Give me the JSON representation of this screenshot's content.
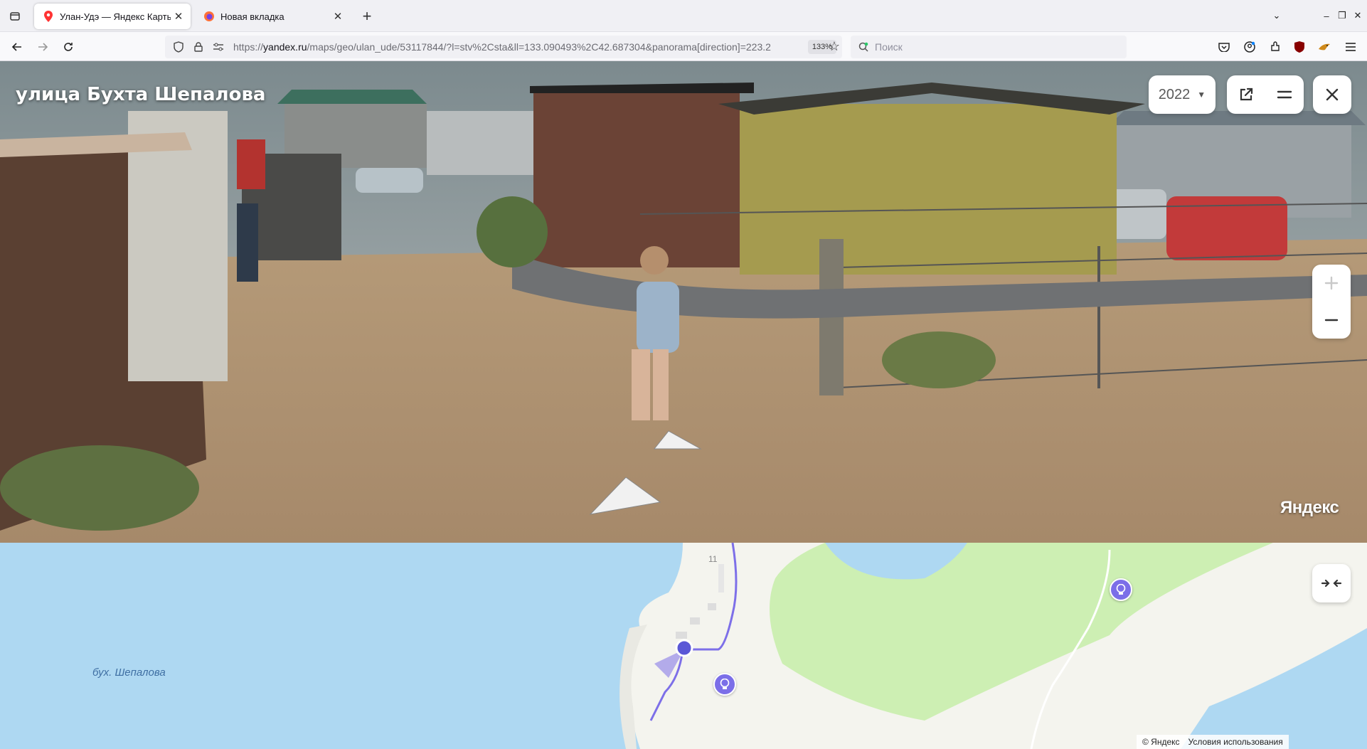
{
  "browser": {
    "tabs": [
      {
        "title": "Улан-Удэ — Яндекс Карты",
        "active": true,
        "icon": "map-pin-icon"
      },
      {
        "title": "Новая вкладка",
        "active": false,
        "icon": "firefox-icon"
      }
    ],
    "url": {
      "prefix": "https://",
      "host": "yandex.ru",
      "path": "/maps/geo/ulan_ude/53117844/?l=stv%2Csta&ll=133.090493%2C42.687304&panorama[direction]=223.2"
    },
    "zoom": "133%",
    "search_placeholder": "Поиск"
  },
  "panorama": {
    "street_title": "улица Бухта Шепалова",
    "year": "2022",
    "logo": "Яндекс"
  },
  "map": {
    "bay_label": "бух. Шепалова",
    "house_number": "11",
    "copyright": "© Яндекс",
    "terms": "Условия использования"
  }
}
